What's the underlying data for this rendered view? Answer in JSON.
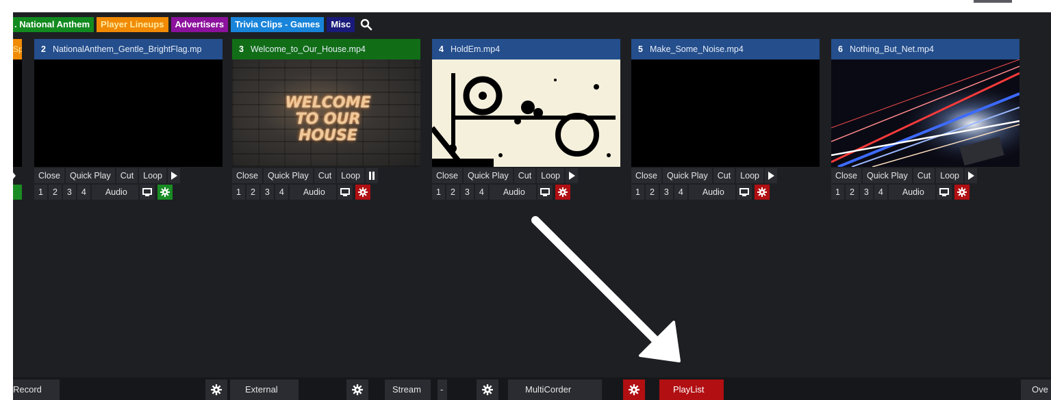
{
  "tabs": [
    {
      "label": ". National Anthem",
      "color": "#128a1f"
    },
    {
      "label": "Player Lineups",
      "color": "#f18a05"
    },
    {
      "label": "Advertisers",
      "color": "#8c119c"
    },
    {
      "label": "Trivia Clips - Games",
      "color": "#1884da"
    },
    {
      "label": "Misc",
      "color": "#1a1a7a"
    }
  ],
  "search_icon": "search-icon",
  "prev_clip_fragment": "Sp",
  "inputs": [
    {
      "number": "2",
      "filename": "NationalAnthem_Gentle_BrightFlag.mp",
      "active": false,
      "state": "play",
      "settings_color": "#1a8c25"
    },
    {
      "number": "3",
      "filename": "Welcome_to_Our_House.mp4",
      "active": true,
      "state": "pause",
      "settings_color": "#b10f12",
      "preview_text": "WELCOME TO OUR HOUSE"
    },
    {
      "number": "4",
      "filename": "HoldEm.mp4",
      "active": false,
      "state": "play",
      "settings_color": "#b10f12"
    },
    {
      "number": "5",
      "filename": "Make_Some_Noise.mp4",
      "active": false,
      "state": "play",
      "settings_color": "#b10f12"
    },
    {
      "number": "6",
      "filename": "Nothing_But_Net.mp4",
      "active": false,
      "state": "play",
      "settings_color": "#b10f12"
    }
  ],
  "controls": {
    "close": "Close",
    "quick_play": "Quick Play",
    "cut": "Cut",
    "loop": "Loop",
    "overlay_1": "1",
    "overlay_2": "2",
    "overlay_3": "3",
    "overlay_4": "4",
    "audio": "Audio"
  },
  "bottom_bar": {
    "record": "Record",
    "external": "External",
    "stream": "Stream",
    "stream_dropdown": "-",
    "multicorder": "MultiCorder",
    "playlist": "PlayList",
    "overlay_fragment": "Ove"
  },
  "colors": {
    "background": "#1e1f23",
    "input_header": "#244e8c",
    "active_header": "#116e17",
    "settings_red": "#b10f12",
    "settings_green": "#1a8c25"
  }
}
